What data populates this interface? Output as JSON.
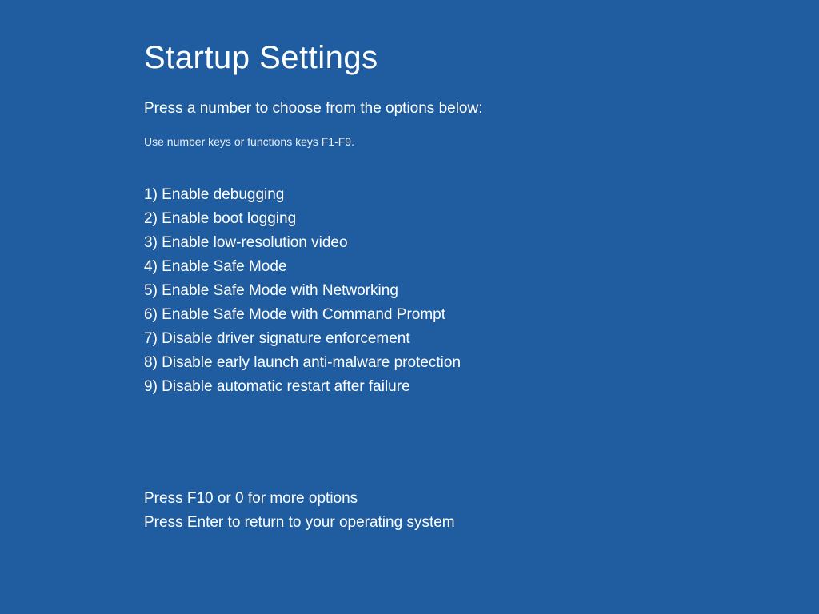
{
  "title": "Startup Settings",
  "instruction": "Press a number to choose from the options below:",
  "hint": "Use number keys or functions keys F1-F9.",
  "options": {
    "item1": "1) Enable debugging",
    "item2": "2) Enable boot logging",
    "item3": "3) Enable low-resolution video",
    "item4": "4) Enable Safe Mode",
    "item5": "5) Enable Safe Mode with Networking",
    "item6": "6) Enable Safe Mode with Command Prompt",
    "item7": "7) Disable driver signature enforcement",
    "item8": "8) Disable early launch anti-malware protection",
    "item9": "9) Disable automatic restart after failure"
  },
  "footer": {
    "line1": "Press F10 or 0 for more options",
    "line2": "Press Enter to return to your operating system"
  },
  "colors": {
    "background": "#1f5da0",
    "text": "#ffffff"
  }
}
